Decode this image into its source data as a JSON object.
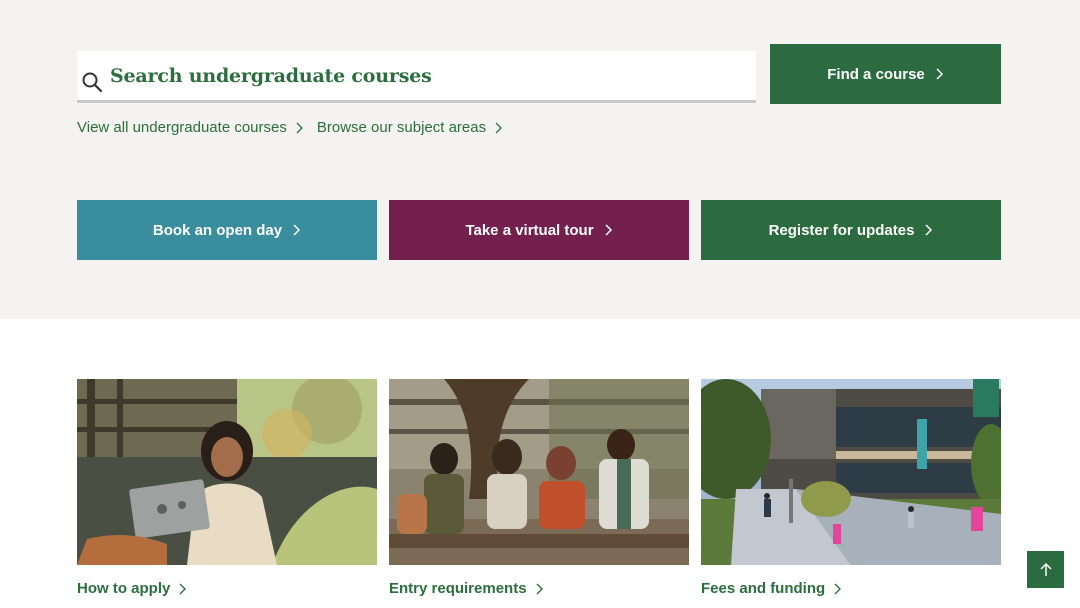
{
  "search": {
    "placeholder": "Search undergraduate courses",
    "button_label": "Find a course"
  },
  "links": [
    {
      "label": "View all undergraduate courses"
    },
    {
      "label": "Browse our subject areas"
    }
  ],
  "actions": [
    {
      "label": "Book an open day",
      "color": "#3a8d9d"
    },
    {
      "label": "Take a virtual tour",
      "color": "#73204f"
    },
    {
      "label": "Register for updates",
      "color": "#2c6b3f"
    }
  ],
  "cards": [
    {
      "label": "How to apply",
      "image": "student-with-laptop-photo"
    },
    {
      "label": "Entry requirements",
      "image": "students-sitting-outdoors-photo"
    },
    {
      "label": "Fees and funding",
      "image": "campus-building-photo"
    }
  ],
  "back_to_top": {
    "icon": "arrow-up-icon"
  },
  "colors": {
    "brand_green": "#2c6b3f",
    "teal": "#3a8d9d",
    "plum": "#73204f",
    "band_background": "#f4f3f1"
  }
}
